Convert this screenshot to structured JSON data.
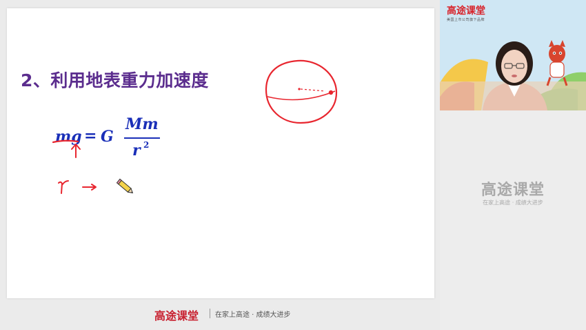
{
  "slide": {
    "heading": "2、利用地表重力加速度",
    "formula": {
      "lhs": "mg",
      "equals": "=",
      "const": "G",
      "numerator": "Mm",
      "denominator": "r",
      "exponent": "2"
    }
  },
  "footer": {
    "logo": "高途课堂",
    "slogan": "在家上高途 · 成绩大进步"
  },
  "sidebar": {
    "video": {
      "logo": "高途课堂",
      "sub": "美国上市公司旗下品牌"
    },
    "watermark": {
      "logo": "高途课堂",
      "slogan": "在家上高途 · 成绩大进步"
    }
  },
  "colors": {
    "heading": "#5b2d8e",
    "formula": "#1a2fb8",
    "ink": "#e8262f",
    "brand": "#c8202f"
  },
  "icons": [
    "pencil-icon"
  ]
}
